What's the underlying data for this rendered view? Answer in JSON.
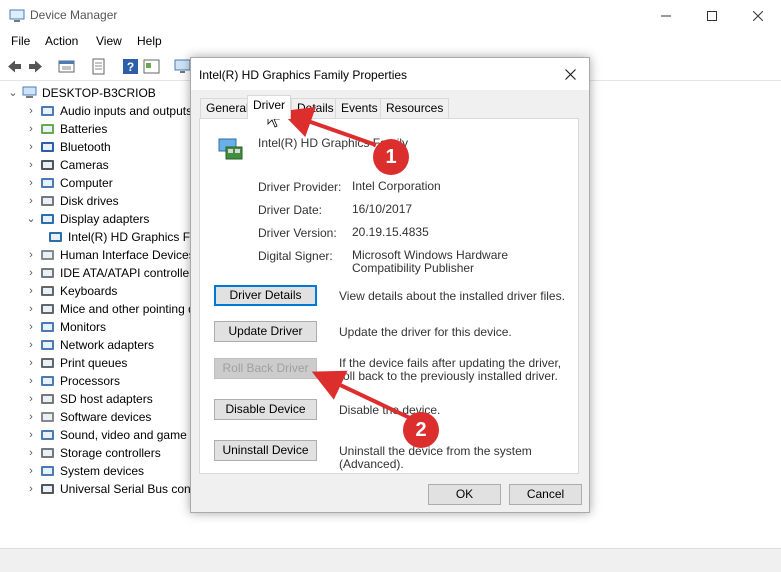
{
  "window": {
    "title": "Device Manager",
    "menu": [
      "File",
      "Action",
      "View",
      "Help"
    ]
  },
  "tree": {
    "root": "DESKTOP-B3CRIOB",
    "categories": [
      {
        "label": "Audio inputs and outputs",
        "icon": "speaker-icon"
      },
      {
        "label": "Batteries",
        "icon": "battery-icon"
      },
      {
        "label": "Bluetooth",
        "icon": "bluetooth-icon"
      },
      {
        "label": "Cameras",
        "icon": "camera-icon"
      },
      {
        "label": "Computer",
        "icon": "computer-icon"
      },
      {
        "label": "Disk drives",
        "icon": "disk-icon"
      },
      {
        "label": "Display adapters",
        "icon": "display-adapter-icon",
        "expanded": true
      },
      {
        "label": "Intel(R) HD Graphics Family",
        "icon": "display-adapter-icon",
        "child": true
      },
      {
        "label": "Human Interface Devices",
        "icon": "hid-icon"
      },
      {
        "label": "IDE ATA/ATAPI controllers",
        "icon": "ide-icon"
      },
      {
        "label": "Keyboards",
        "icon": "keyboard-icon"
      },
      {
        "label": "Mice and other pointing devices",
        "icon": "mouse-icon"
      },
      {
        "label": "Monitors",
        "icon": "monitor-icon"
      },
      {
        "label": "Network adapters",
        "icon": "network-icon"
      },
      {
        "label": "Print queues",
        "icon": "printer-icon"
      },
      {
        "label": "Processors",
        "icon": "processor-icon"
      },
      {
        "label": "SD host adapters",
        "icon": "sd-icon"
      },
      {
        "label": "Software devices",
        "icon": "software-icon"
      },
      {
        "label": "Sound, video and game controllers",
        "icon": "sound-icon"
      },
      {
        "label": "Storage controllers",
        "icon": "storage-icon"
      },
      {
        "label": "System devices",
        "icon": "system-icon"
      },
      {
        "label": "Universal Serial Bus controllers",
        "icon": "usb-icon"
      }
    ]
  },
  "dialog": {
    "title": "Intel(R) HD Graphics Family Properties",
    "tabs": [
      "General",
      "Driver",
      "Details",
      "Events",
      "Resources"
    ],
    "active_tab": "Driver",
    "device_name": "Intel(R) HD Graphics Family",
    "fields": [
      {
        "label": "Driver Provider:",
        "value": "Intel Corporation"
      },
      {
        "label": "Driver Date:",
        "value": "16/10/2017"
      },
      {
        "label": "Driver Version:",
        "value": "20.19.15.4835"
      },
      {
        "label": "Digital Signer:",
        "value": "Microsoft Windows Hardware Compatibility Publisher"
      }
    ],
    "actions": [
      {
        "label": "Driver Details",
        "desc": "View details about the installed driver files."
      },
      {
        "label": "Update Driver",
        "desc": "Update the driver for this device."
      },
      {
        "label": "Roll Back Driver",
        "desc": "If the device fails after updating the driver, roll back to the previously installed driver.",
        "disabled": true
      },
      {
        "label": "Disable Device",
        "desc": "Disable the device."
      },
      {
        "label": "Uninstall Device",
        "desc": "Uninstall the device from the system (Advanced)."
      }
    ],
    "ok_label": "OK",
    "cancel_label": "Cancel"
  },
  "annotations": {
    "marker_1": "1",
    "marker_2": "2",
    "color": "#dd2e2e"
  }
}
